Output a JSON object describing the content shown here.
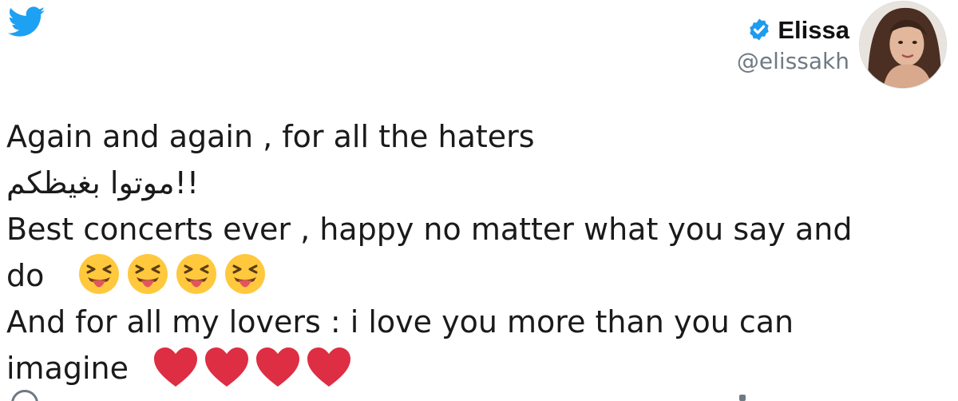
{
  "brand": {
    "logo_icon": "twitter-bird-icon",
    "color": "#1da1f2"
  },
  "author": {
    "display_name": "Elissa",
    "handle": "@elissakh",
    "verified_icon": "verified-badge-icon",
    "avatar_icon": "profile-photo"
  },
  "tweet": {
    "line1": "Again and again , for all the haters",
    "line2_arabic": "!!موتوا بغيظكم",
    "line3": "Best concerts ever , happy no matter what you say and",
    "line4": "do",
    "line4_emoji": [
      "😝",
      "😝",
      "😝",
      "😝"
    ],
    "line5": "And for all my lovers : i love you more than you can",
    "line6": "imagine",
    "line6_emoji": [
      "❤️",
      "❤️",
      "❤️",
      "❤️"
    ]
  },
  "colors": {
    "text": "#1a1a1a",
    "secondary": "#6f7a83",
    "heart": "#dd2e44",
    "emoji_face": "#ffc83d"
  },
  "bottom_icons": [
    "reply-icon",
    "action-icon"
  ]
}
